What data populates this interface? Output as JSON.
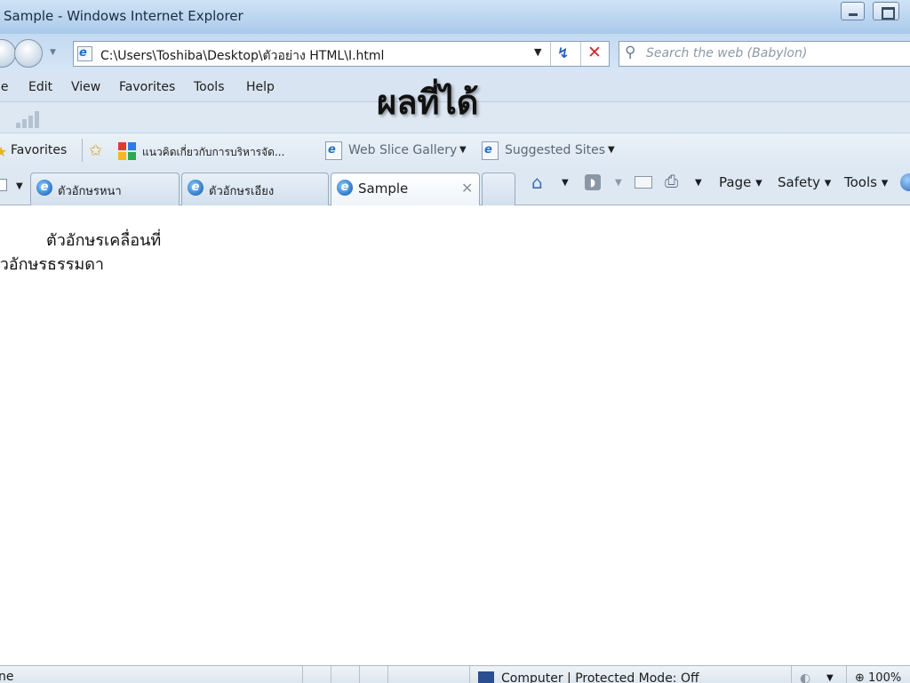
{
  "window": {
    "title": "Sample - Windows Internet Explorer"
  },
  "address_bar": {
    "url": "C:\\Users\\Toshiba\\Desktop\\ตัวอย่าง HTML\\I.html"
  },
  "search": {
    "placeholder": "Search the web (Babylon)"
  },
  "menu": {
    "items": [
      "le",
      "Edit",
      "View",
      "Favorites",
      "Tools",
      "Help"
    ]
  },
  "overlay": {
    "caption": "ผลที่ได้"
  },
  "favorites_bar": {
    "label": "Favorites",
    "items": [
      {
        "label": "แนวคิดเกี่ยวกับการบริหารจัด..."
      },
      {
        "label": "Web Slice Gallery"
      },
      {
        "label": "Suggested Sites"
      }
    ]
  },
  "tabs": [
    {
      "label": "ตัวอักษรหนา",
      "active": false
    },
    {
      "label": "ตัวอักษรเอียง",
      "active": false
    },
    {
      "label": "Sample",
      "active": true
    }
  ],
  "command_bar": {
    "page": "Page",
    "safety": "Safety",
    "tools": "Tools"
  },
  "content": {
    "marquee_text": "ตัวอักษรเคลื่อนที่",
    "normal_text": "ตัวอักษรธรรมดา"
  },
  "status_bar": {
    "status": "ne",
    "zone": "Computer | Protected Mode: Off",
    "zoom": "100%"
  },
  "icons": {
    "back": "back-arrow-icon",
    "forward": "forward-arrow-icon",
    "refresh": "refresh-icon",
    "stop": "stop-icon",
    "search": "search-icon",
    "favorites": "star-icon",
    "home": "home-icon",
    "feeds": "feeds-icon",
    "mail": "mail-icon",
    "print": "print-icon",
    "help": "help-icon"
  },
  "colors": {
    "chrome": "#d8e4f1",
    "stop": "#d02a2a",
    "link_accent": "#2b62c2"
  }
}
